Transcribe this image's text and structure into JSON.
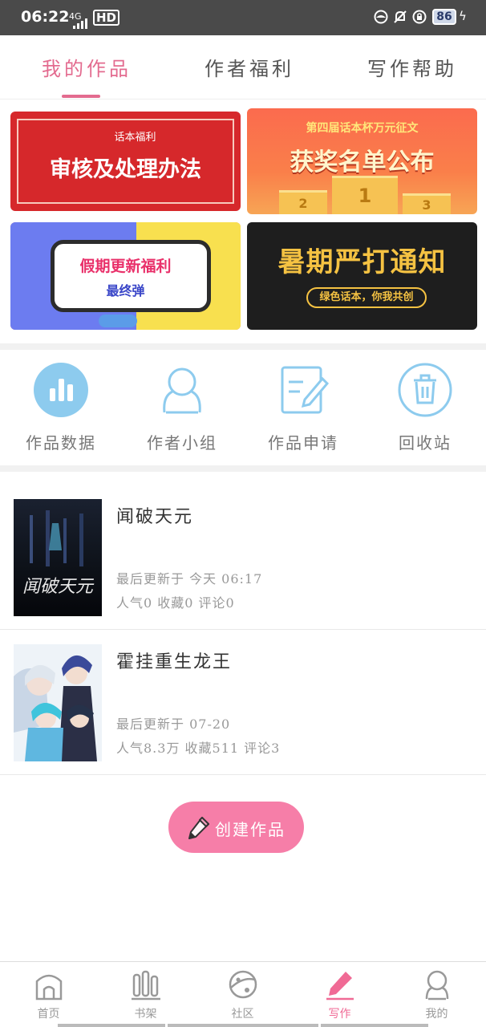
{
  "status_bar": {
    "time": "06:22",
    "network": "4G",
    "hd": "HD",
    "battery": "86"
  },
  "tabs": [
    {
      "label": "我的作品",
      "active": true
    },
    {
      "label": "作者福利",
      "active": false
    },
    {
      "label": "写作帮助",
      "active": false
    }
  ],
  "banners": {
    "b1": {
      "tag": "话本福利",
      "title": "审核及处理办法"
    },
    "b2": {
      "subtitle": "第四届话本杯万元征文",
      "title": "获奖名单公布",
      "podium": [
        "2",
        "1",
        "3"
      ]
    },
    "b3": {
      "title": "假期更新福利",
      "subtitle": "最终弹"
    },
    "b4": {
      "title": "暑期严打通知",
      "pill": "绿色话本，你我共创"
    }
  },
  "shortcuts": [
    {
      "label": "作品数据",
      "icon": "bar-chart-icon"
    },
    {
      "label": "作者小组",
      "icon": "group-icon"
    },
    {
      "label": "作品申请",
      "icon": "edit-document-icon"
    },
    {
      "label": "回收站",
      "icon": "trash-icon"
    }
  ],
  "works": [
    {
      "title": "闻破天元",
      "updated": "最后更新于 今天 06:17",
      "stats": "人气0 收藏0 评论0",
      "cover_text": "闻破天元"
    },
    {
      "title": "霍挂重生龙王",
      "updated": "最后更新于 07-20",
      "stats": "人气8.3万 收藏511 评论3"
    }
  ],
  "create_button": {
    "label": "创建作品"
  },
  "bottom_nav": [
    {
      "label": "首页",
      "icon": "home-icon",
      "active": false
    },
    {
      "label": "书架",
      "icon": "bookshelf-icon",
      "active": false
    },
    {
      "label": "社区",
      "icon": "planet-icon",
      "active": false
    },
    {
      "label": "写作",
      "icon": "pencil-icon",
      "active": true
    },
    {
      "label": "我的",
      "icon": "profile-icon",
      "active": false
    }
  ],
  "colors": {
    "accent": "#e36b8f",
    "create_button": "#f67ea8",
    "shortcut_icon": "#8dcbee"
  }
}
